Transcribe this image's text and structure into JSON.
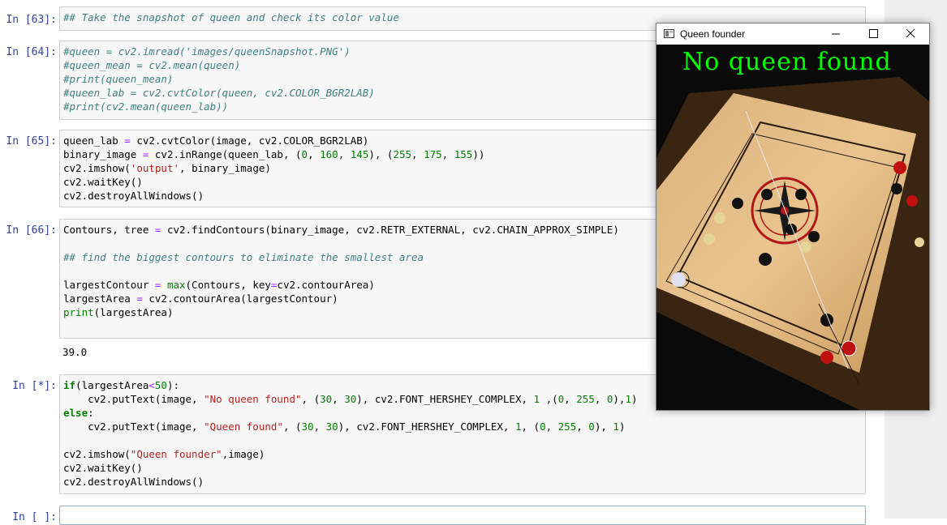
{
  "cells": [
    {
      "prompt": "In [63]:",
      "lines": [
        [
          [
            "c",
            "## Take the snapshot of queen and check its color value"
          ]
        ]
      ]
    },
    {
      "prompt": "In [64]:",
      "lines": [
        [
          [
            "c",
            "#queen = cv2.imread('images/queenSnapshot.PNG')"
          ]
        ],
        [
          [
            "c",
            "#queen_mean = cv2.mean(queen)"
          ]
        ],
        [
          [
            "c",
            "#print(queen_mean)"
          ]
        ],
        [
          [
            "c",
            "#queen_lab = cv2.cvtColor(queen, cv2.COLOR_BGR2LAB)"
          ]
        ],
        [
          [
            "c",
            "#print(cv2.mean(queen_lab))"
          ]
        ]
      ]
    },
    {
      "prompt": "In [65]:",
      "lines": [
        [
          [
            "t",
            "queen_lab "
          ],
          [
            "o",
            "="
          ],
          [
            "t",
            " cv2.cvtColor(image, cv2.COLOR_BGR2LAB)"
          ]
        ],
        [
          [
            "t",
            "binary_image "
          ],
          [
            "o",
            "="
          ],
          [
            "t",
            " cv2.inRange(queen_lab, ("
          ],
          [
            "n",
            "0"
          ],
          [
            "t",
            ", "
          ],
          [
            "n",
            "160"
          ],
          [
            "t",
            ", "
          ],
          [
            "n",
            "145"
          ],
          [
            "t",
            "), ("
          ],
          [
            "n",
            "255"
          ],
          [
            "t",
            ", "
          ],
          [
            "n",
            "175"
          ],
          [
            "t",
            ", "
          ],
          [
            "n",
            "155"
          ],
          [
            "t",
            "))"
          ]
        ],
        [
          [
            "t",
            "cv2.imshow("
          ],
          [
            "s",
            "'output'"
          ],
          [
            "t",
            ", binary_image)"
          ]
        ],
        [
          [
            "t",
            "cv2.waitKey()"
          ]
        ],
        [
          [
            "t",
            "cv2.destroyAllWindows()"
          ]
        ]
      ]
    },
    {
      "prompt": "In [66]:",
      "lines": [
        [
          [
            "t",
            "Contours, tree "
          ],
          [
            "o",
            "="
          ],
          [
            "t",
            " cv2.findContours(binary_image, cv2.RETR_EXTERNAL, cv2.CHAIN_APPROX_SIMPLE)"
          ]
        ],
        [
          [
            "t",
            ""
          ]
        ],
        [
          [
            "c",
            "## find the biggest contours to eliminate the smallest area"
          ]
        ],
        [
          [
            "t",
            ""
          ]
        ],
        [
          [
            "t",
            "largestContour "
          ],
          [
            "o",
            "="
          ],
          [
            "t",
            " "
          ],
          [
            "b",
            "max"
          ],
          [
            "t",
            "(Contours, key"
          ],
          [
            "o",
            "="
          ],
          [
            "t",
            "cv2.contourArea)"
          ]
        ],
        [
          [
            "t",
            "largestArea "
          ],
          [
            "o",
            "="
          ],
          [
            "t",
            " cv2.contourArea(largestContour)"
          ]
        ],
        [
          [
            "b",
            "print"
          ],
          [
            "t",
            "(largestArea)"
          ]
        ]
      ],
      "output": "39.0"
    },
    {
      "prompt": "In [*]:",
      "lines": [
        [
          [
            "k",
            "if"
          ],
          [
            "t",
            "(largestArea"
          ],
          [
            "o",
            "<"
          ],
          [
            "n",
            "50"
          ],
          [
            "t",
            "):"
          ]
        ],
        [
          [
            "t",
            "    cv2.putText(image, "
          ],
          [
            "s",
            "\"No queen found\""
          ],
          [
            "t",
            ", ("
          ],
          [
            "n",
            "30"
          ],
          [
            "t",
            ", "
          ],
          [
            "n",
            "30"
          ],
          [
            "t",
            "), cv2.FONT_HERSHEY_COMPLEX, "
          ],
          [
            "n",
            "1"
          ],
          [
            "t",
            " ,("
          ],
          [
            "n",
            "0"
          ],
          [
            "t",
            ", "
          ],
          [
            "n",
            "255"
          ],
          [
            "t",
            ", "
          ],
          [
            "n",
            "0"
          ],
          [
            "t",
            "),"
          ],
          [
            "n",
            "1"
          ],
          [
            "t",
            ")"
          ]
        ],
        [
          [
            "k",
            "else"
          ],
          [
            "t",
            ":"
          ]
        ],
        [
          [
            "t",
            "    cv2.putText(image, "
          ],
          [
            "s",
            "\"Queen found\""
          ],
          [
            "t",
            ", ("
          ],
          [
            "n",
            "30"
          ],
          [
            "t",
            ", "
          ],
          [
            "n",
            "30"
          ],
          [
            "t",
            "), cv2.FONT_HERSHEY_COMPLEX, "
          ],
          [
            "n",
            "1"
          ],
          [
            "t",
            ", ("
          ],
          [
            "n",
            "0"
          ],
          [
            "t",
            ", "
          ],
          [
            "n",
            "255"
          ],
          [
            "t",
            ", "
          ],
          [
            "n",
            "0"
          ],
          [
            "t",
            "), "
          ],
          [
            "n",
            "1"
          ],
          [
            "t",
            ")"
          ]
        ],
        [
          [
            "t",
            ""
          ]
        ],
        [
          [
            "t",
            "cv2.imshow("
          ],
          [
            "s",
            "\"Queen founder\""
          ],
          [
            "t",
            ",image)"
          ]
        ],
        [
          [
            "t",
            "cv2.waitKey()"
          ]
        ],
        [
          [
            "t",
            "cv2.destroyAllWindows()"
          ]
        ]
      ]
    },
    {
      "prompt": "In [ ]:",
      "lines": []
    }
  ],
  "popup": {
    "title": "Queen founder",
    "overlay_text": "No queen found",
    "controls": [
      "minimize-icon",
      "maximize-icon",
      "close-icon"
    ],
    "overlay_color": "#00ff00"
  },
  "colors": {
    "prompt": "#303f9f",
    "comment": "#408080",
    "string": "#ba2121",
    "number": "#008000",
    "operator": "#aa22ff",
    "keyword": "#008000",
    "cell_background": "#f7f7f7",
    "cell_border": "#cfcfcf"
  }
}
